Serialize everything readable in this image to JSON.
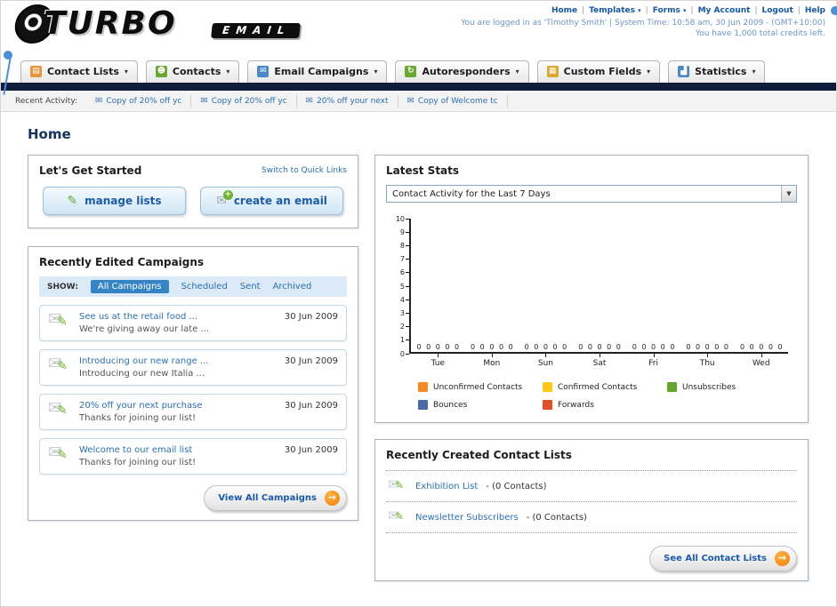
{
  "icons": {
    "caret": "▾",
    "envelope": "✉",
    "pencil": "✎",
    "arrow": "→",
    "plus": "+",
    "dropdown_arrow": "▼",
    "sep": "|"
  },
  "header": {
    "logo_top": "TURBO",
    "logo_bottom": "EMAIL",
    "links": [
      "Home",
      "Templates",
      "Forms",
      "My Account",
      "Logout",
      "Help"
    ],
    "login_line": "You are logged in as 'Timothy Smith' | System Time: 10:58 am, 30 Jun 2009 - (GMT+10:00)",
    "credits_line": "You have 1,000 total credits left."
  },
  "nav": {
    "items": [
      {
        "label": "Contact Lists",
        "glyph": "▤"
      },
      {
        "label": "Contacts",
        "glyph": "☻"
      },
      {
        "label": "Email Campaigns",
        "glyph": "✉"
      },
      {
        "label": "Autoresponders",
        "glyph": "↻"
      },
      {
        "label": "Custom Fields",
        "glyph": "▦"
      },
      {
        "label": "Statistics",
        "glyph": "▟"
      }
    ]
  },
  "activity": {
    "label": "Recent Activity:",
    "items": [
      "Copy of 20% off yc",
      "Copy of 20% off yc",
      "20% off your next",
      "Copy of Welcome tc"
    ]
  },
  "page": {
    "title": "Home"
  },
  "get_started": {
    "title": "Let's Get Started",
    "switch_link": "Switch to Quick Links",
    "manage_lists": "manage lists",
    "create_email": "create an email"
  },
  "campaigns": {
    "title": "Recently Edited Campaigns",
    "show_label": "SHOW:",
    "tabs": [
      "All Campaigns",
      "Scheduled",
      "Sent",
      "Archived"
    ],
    "items": [
      {
        "title": "See us at the retail food ...",
        "subtitle": "We're giving away our late ...",
        "date": "30 Jun 2009"
      },
      {
        "title": "Introducing our new range ...",
        "subtitle": "Introducing our new Italia ...",
        "date": "30 Jun 2009"
      },
      {
        "title": "20% off your next purchase",
        "subtitle": "Thanks for joining our list!",
        "date": "30 Jun 2009"
      },
      {
        "title": "Welcome to our email list",
        "subtitle": "Thanks for joining our list!",
        "date": "30 Jun 2009"
      }
    ],
    "view_all": "View All Campaigns"
  },
  "stats": {
    "title": "Latest Stats",
    "dropdown_value": "Contact Activity for the Last 7 Days"
  },
  "chart_data": {
    "type": "bar",
    "title": "Contact Activity for the Last 7 Days",
    "categories": [
      "Tue",
      "Mon",
      "Sun",
      "Sat",
      "Fri",
      "Thu",
      "Wed"
    ],
    "series": [
      {
        "name": "Unconfirmed Contacts",
        "color": "#f6891f",
        "values": [
          0,
          0,
          0,
          0,
          0,
          0,
          0
        ]
      },
      {
        "name": "Confirmed Contacts",
        "color": "#fdc816",
        "values": [
          0,
          0,
          0,
          0,
          0,
          0,
          0
        ]
      },
      {
        "name": "Unsubscribes",
        "color": "#64a62c",
        "values": [
          0,
          0,
          0,
          0,
          0,
          0,
          0
        ]
      },
      {
        "name": "Bounces",
        "color": "#4a69a5",
        "values": [
          0,
          0,
          0,
          0,
          0,
          0,
          0
        ]
      },
      {
        "name": "Forwards",
        "color": "#e2502b",
        "values": [
          0,
          0,
          0,
          0,
          0,
          0,
          0
        ]
      }
    ],
    "ylim": [
      0,
      10
    ],
    "ytick_step": 1,
    "grid": false,
    "legend_position": "bottom"
  },
  "contact_lists": {
    "title": "Recently Created Contact Lists",
    "items": [
      {
        "name": "Exhibition List",
        "suffix": "- (0 Contacts)"
      },
      {
        "name": "Newsletter Subscribers",
        "suffix": "- (0 Contacts)"
      }
    ],
    "see_all": "See All Contact Lists"
  }
}
